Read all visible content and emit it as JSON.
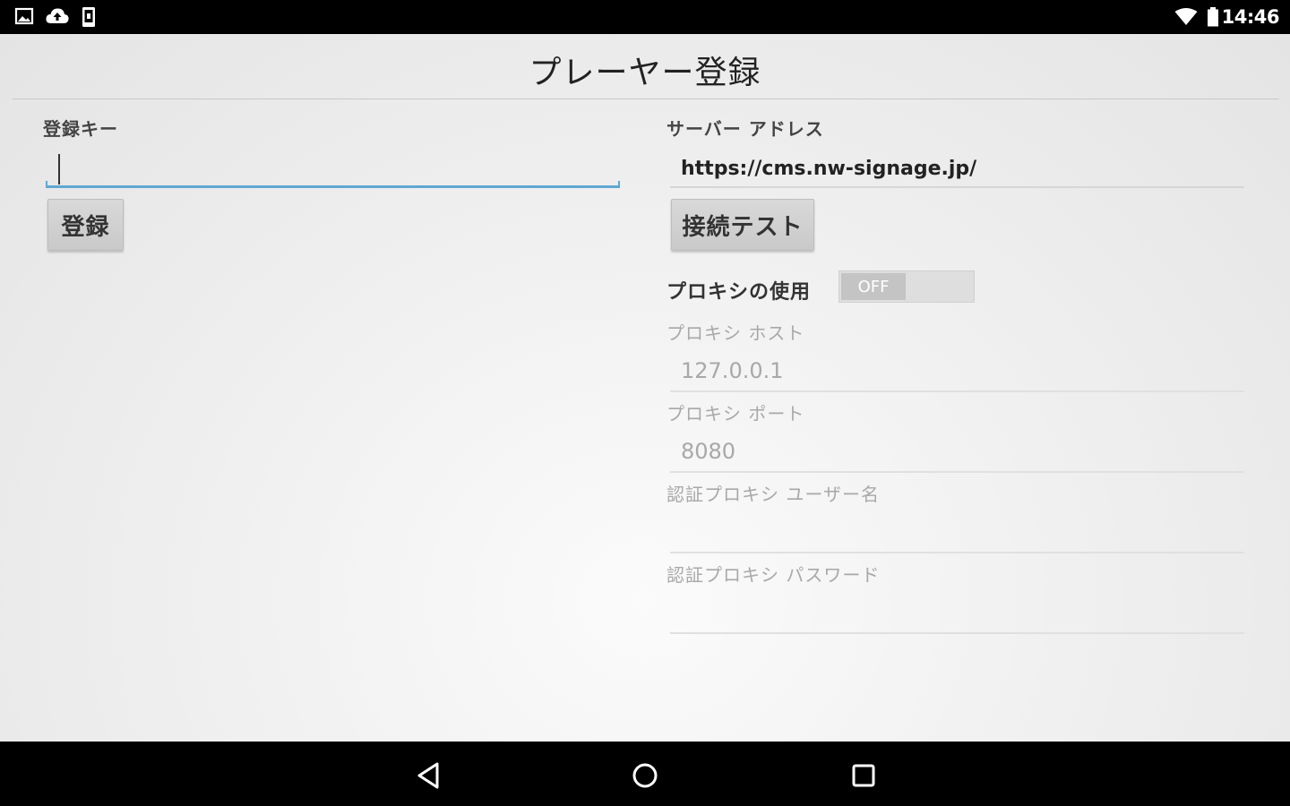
{
  "status_bar": {
    "time": "14:46",
    "left_icons": [
      "image-icon",
      "cloud-upload-icon",
      "phone-icon"
    ],
    "right_icons": [
      "wifi-icon",
      "battery-icon"
    ]
  },
  "page": {
    "title": "プレーヤー登録"
  },
  "registration": {
    "key_label": "登録キー",
    "key_value": "",
    "register_button": "登録"
  },
  "server": {
    "address_label": "サーバー アドレス",
    "address_value": "https://cms.nw-signage.jp/",
    "test_button": "接続テスト"
  },
  "proxy": {
    "use_label": "プロキシの使用",
    "toggle_state": "OFF",
    "host_label": "プロキシ ホスト",
    "host_value": "127.0.0.1",
    "port_label": "プロキシ ポート",
    "port_value": "8080",
    "username_label": "認証プロキシ ユーザー名",
    "username_value": "",
    "password_label": "認証プロキシ パスワード",
    "password_value": ""
  },
  "nav_bar": {
    "buttons": [
      "back-icon",
      "home-icon",
      "recents-icon"
    ]
  },
  "colors": {
    "status_bar": "#000000",
    "background": "#eeeeee",
    "accent_focus": "#5fa8d3",
    "disabled_text": "#a8a8a8",
    "button": "#d3d3d3"
  }
}
